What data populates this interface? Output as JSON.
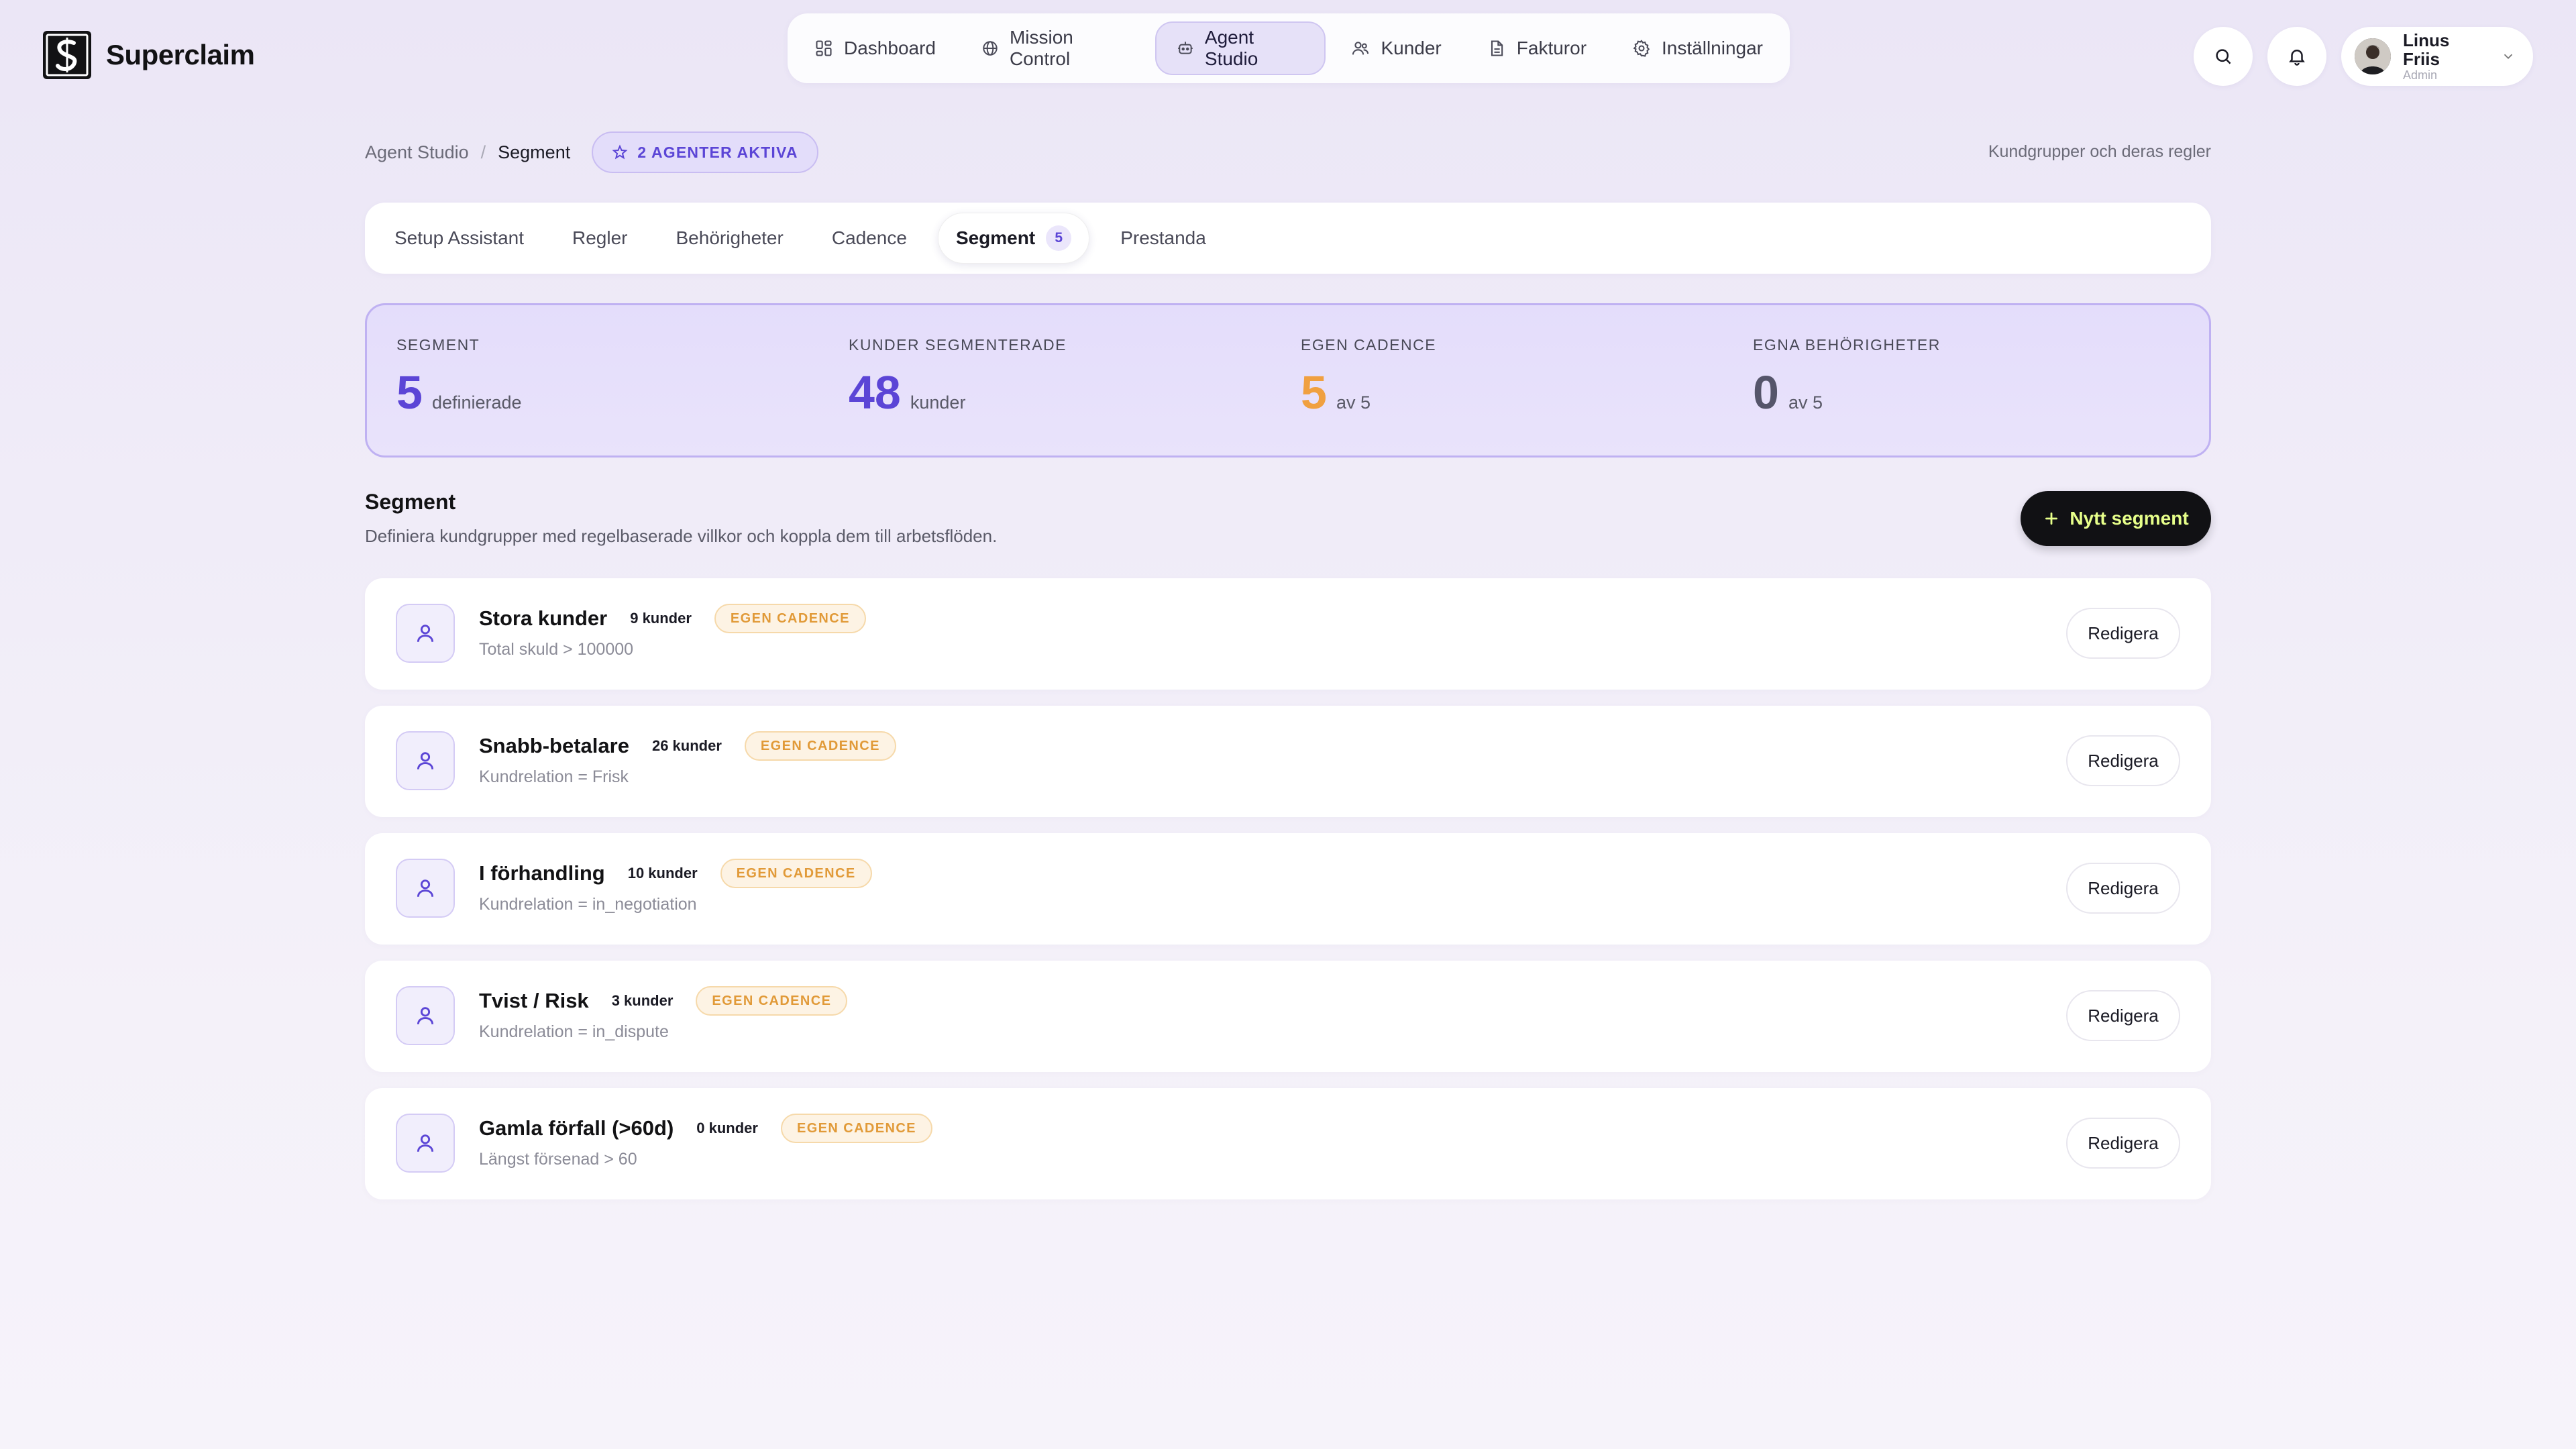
{
  "brand": {
    "name": "Superclaim"
  },
  "nav": [
    {
      "label": "Dashboard",
      "icon": "grid-icon"
    },
    {
      "label": "Mission Control",
      "icon": "globe-icon"
    },
    {
      "label": "Agent Studio",
      "icon": "robot-icon",
      "active": true
    },
    {
      "label": "Kunder",
      "icon": "users-icon"
    },
    {
      "label": "Fakturor",
      "icon": "document-icon"
    },
    {
      "label": "Inställningar",
      "icon": "gear-icon"
    }
  ],
  "user": {
    "name": "Linus Friis",
    "role": "Admin"
  },
  "breadcrumb": {
    "parent": "Agent Studio",
    "separator": "/",
    "current": "Segment",
    "badge": "2 AGENTER AKTIVA",
    "right_text": "Kundgrupper och deras regler"
  },
  "tabs": [
    {
      "label": "Setup Assistant"
    },
    {
      "label": "Regler"
    },
    {
      "label": "Behörigheter"
    },
    {
      "label": "Cadence"
    },
    {
      "label": "Segment",
      "count": "5",
      "active": true
    },
    {
      "label": "Prestanda"
    }
  ],
  "stats": [
    {
      "label": "SEGMENT",
      "value": "5",
      "sub": "definierade",
      "color": "#5b45d6"
    },
    {
      "label": "KUNDER SEGMENTERADE",
      "value": "48",
      "sub": "kunder",
      "color": "#5b45d6"
    },
    {
      "label": "EGEN CADENCE",
      "value": "5",
      "sub": "av 5",
      "color": "#f0a040"
    },
    {
      "label": "EGNA BEHÖRIGHETER",
      "value": "0",
      "sub": "av 5",
      "color": "#55556a"
    }
  ],
  "section": {
    "title": "Segment",
    "description": "Definiera kundgrupper med regelbaserade villkor och koppla dem till arbetsflöden.",
    "new_button": "Nytt segment"
  },
  "segments": [
    {
      "name": "Stora kunder",
      "count": "9 kunder",
      "badge": "EGEN CADENCE",
      "rule": "Total skuld > 100000",
      "action": "Redigera"
    },
    {
      "name": "Snabb-betalare",
      "count": "26 kunder",
      "badge": "EGEN CADENCE",
      "rule": "Kundrelation = Frisk",
      "action": "Redigera"
    },
    {
      "name": "I förhandling",
      "count": "10 kunder",
      "badge": "EGEN CADENCE",
      "rule": "Kundrelation = in_negotiation",
      "action": "Redigera"
    },
    {
      "name": "Tvist / Risk",
      "count": "3 kunder",
      "badge": "EGEN CADENCE",
      "rule": "Kundrelation = in_dispute",
      "action": "Redigera"
    },
    {
      "name": "Gamla förfall (>60d)",
      "count": "0 kunder",
      "badge": "EGEN CADENCE",
      "rule": "Längst försenad > 60",
      "action": "Redigera"
    }
  ]
}
